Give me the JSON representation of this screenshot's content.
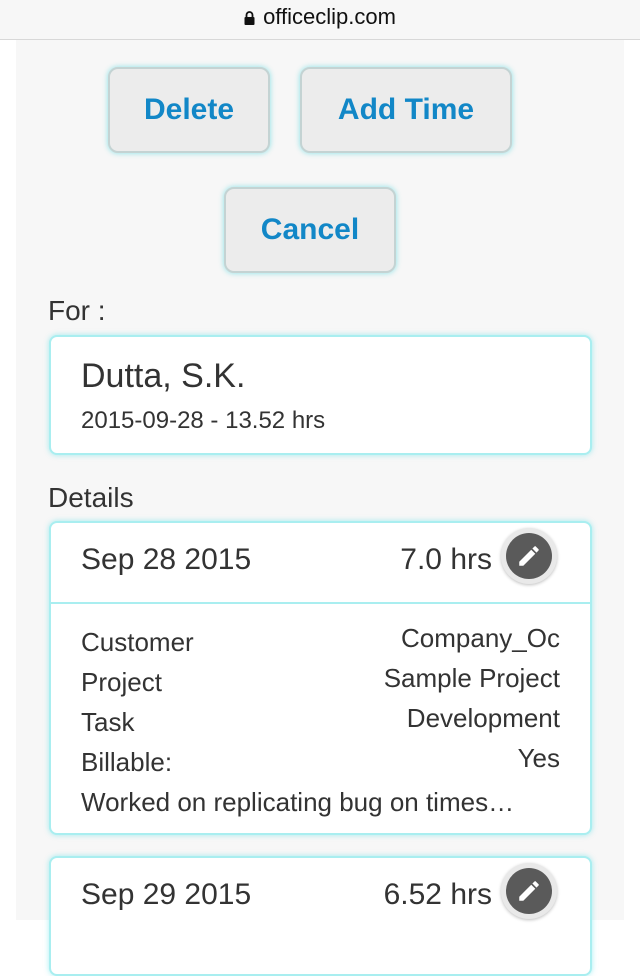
{
  "browser": {
    "url": "officeclip.com"
  },
  "actions": {
    "delete_label": "Delete",
    "add_time_label": "Add Time",
    "cancel_label": "Cancel"
  },
  "for_section": {
    "label": "For :",
    "name": "Dutta, S.K.",
    "summary": "2015-09-28 - 13.52 hrs"
  },
  "details": {
    "label": "Details",
    "entries": [
      {
        "date": "Sep 28 2015",
        "hours": "7.0 hrs",
        "fields": [
          {
            "label": "Customer",
            "value": "Company_Oc"
          },
          {
            "label": "Project",
            "value": "Sample Project"
          },
          {
            "label": "Task",
            "value": "Development"
          },
          {
            "label": "Billable:",
            "value": "Yes"
          }
        ],
        "description": "Worked on replicating bug on times…"
      },
      {
        "date": "Sep 29 2015",
        "hours": "6.52 hrs"
      }
    ]
  },
  "icons": {
    "lock": "lock-icon",
    "edit": "pencil-icon"
  },
  "colors": {
    "accent": "#1287c7",
    "card_border": "#a9eef0",
    "page_bg": "#f7f7f7"
  }
}
